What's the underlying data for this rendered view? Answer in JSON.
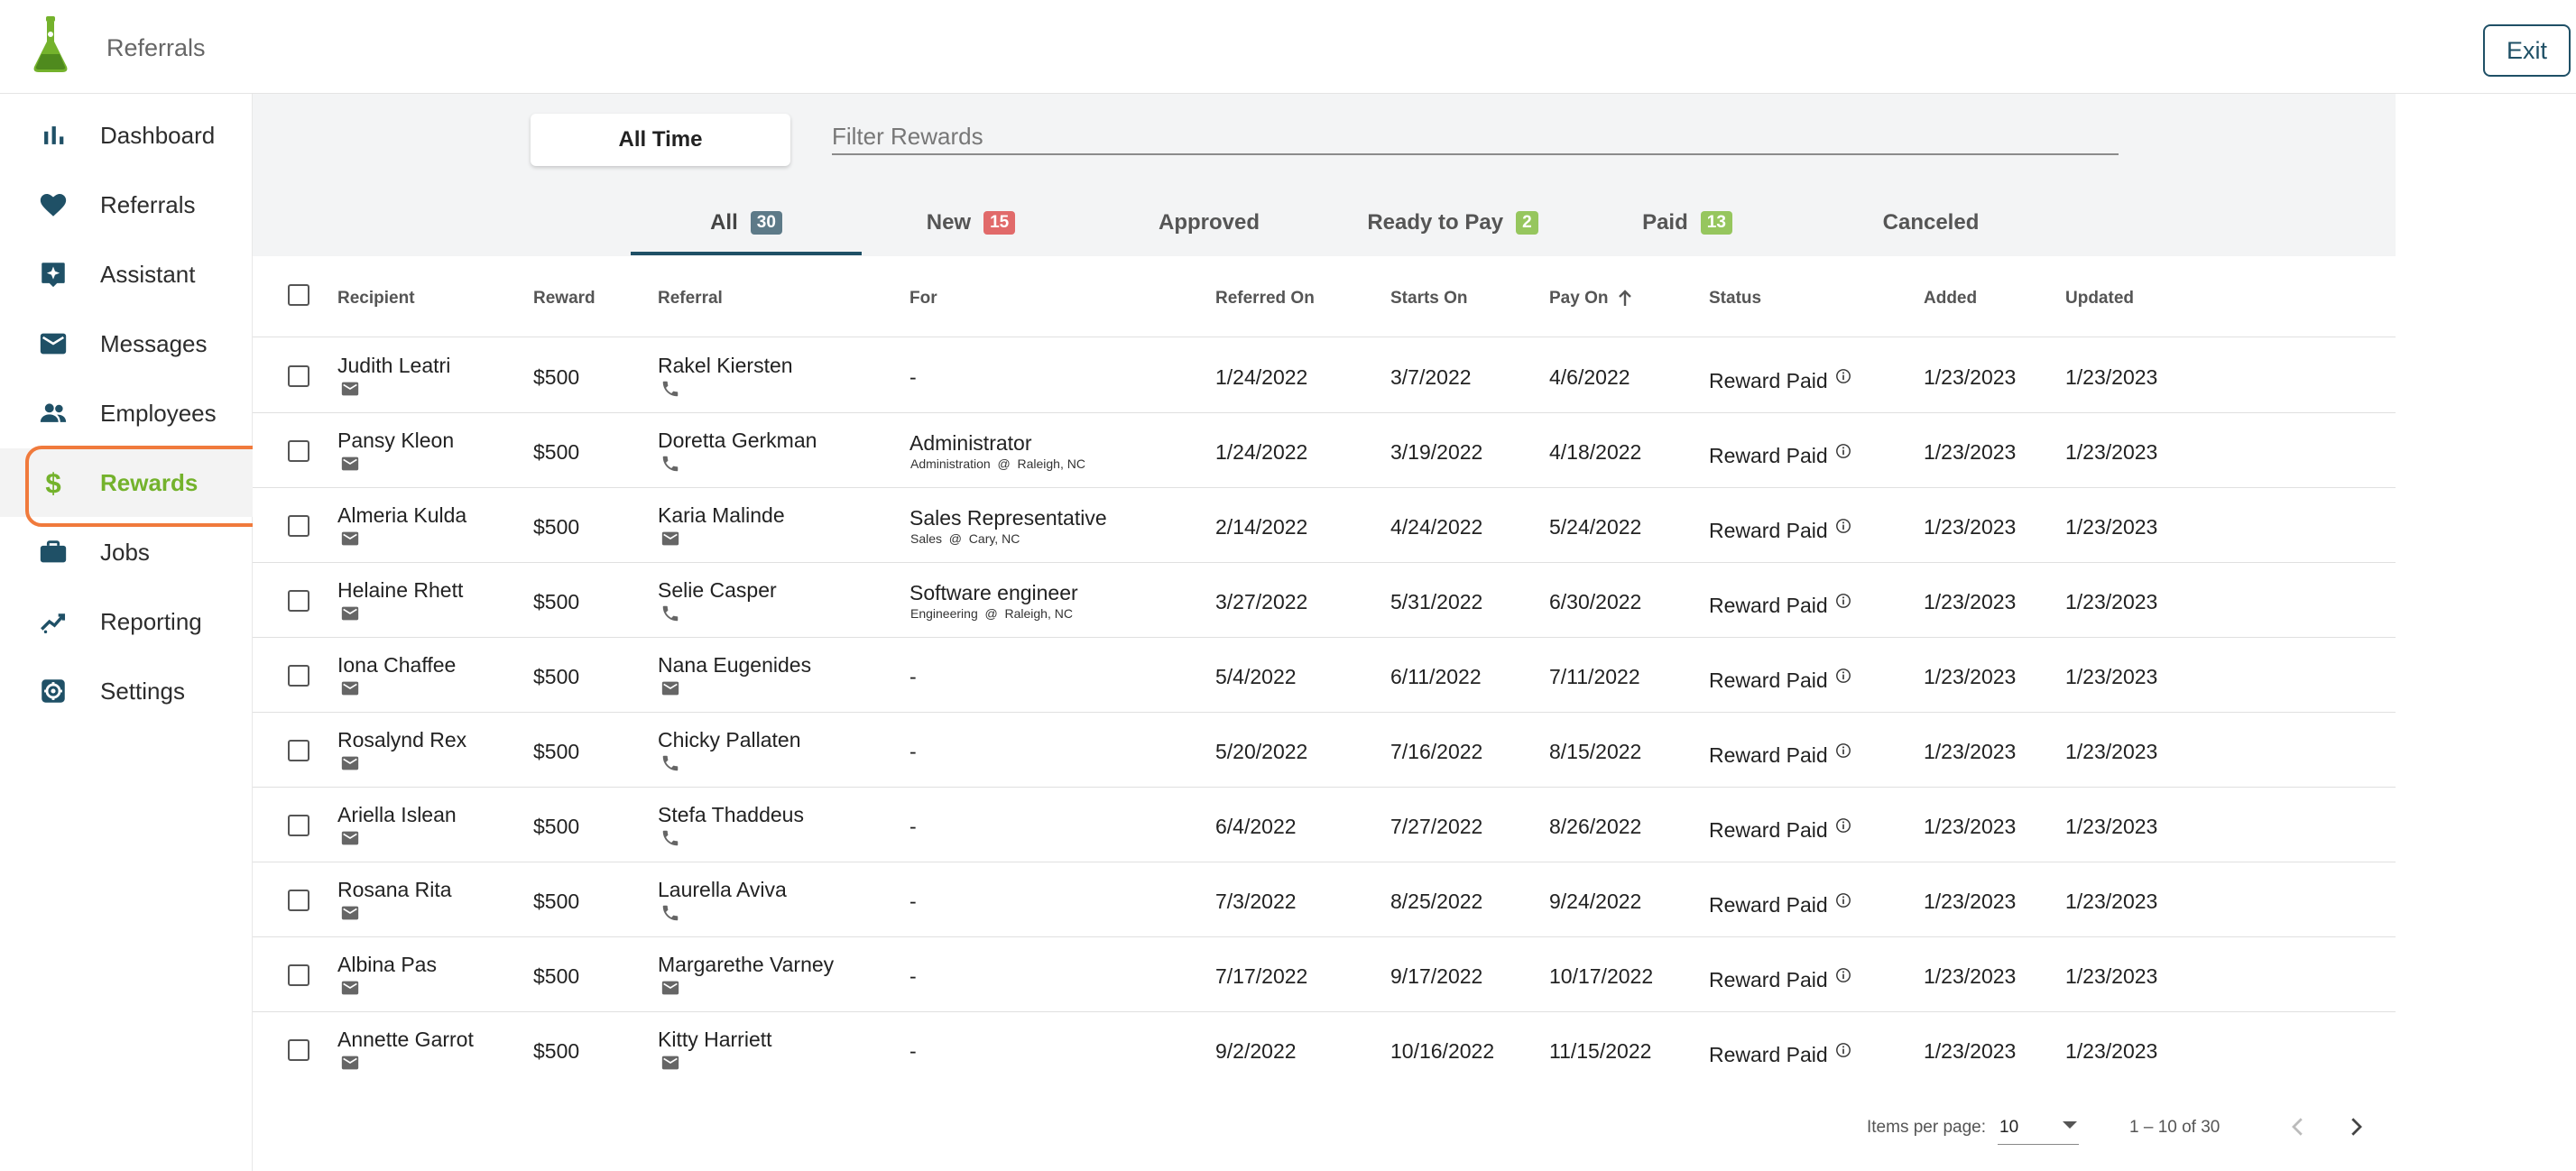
{
  "app": {
    "title": "Referrals",
    "exit_label": "Exit"
  },
  "sidebar": {
    "items": [
      {
        "label": "Dashboard",
        "icon": "bar-chart-icon"
      },
      {
        "label": "Referrals",
        "icon": "heart-icon"
      },
      {
        "label": "Assistant",
        "icon": "sparkle-icon"
      },
      {
        "label": "Messages",
        "icon": "mail-icon"
      },
      {
        "label": "Employees",
        "icon": "people-icon"
      },
      {
        "label": "Rewards",
        "icon": "dollar-icon",
        "active": true
      },
      {
        "label": "Jobs",
        "icon": "briefcase-icon"
      },
      {
        "label": "Reporting",
        "icon": "trending-icon"
      },
      {
        "label": "Settings",
        "icon": "gear-icon"
      }
    ]
  },
  "filter": {
    "time_label": "All Time",
    "placeholder": "Filter Rewards"
  },
  "tabs": [
    {
      "label": "All",
      "count": "30",
      "badge": "gray"
    },
    {
      "label": "New",
      "count": "15",
      "badge": "red"
    },
    {
      "label": "Approved",
      "count": "",
      "badge": ""
    },
    {
      "label": "Ready to Pay",
      "count": "2",
      "badge": "green"
    },
    {
      "label": "Paid",
      "count": "13",
      "badge": "green"
    },
    {
      "label": "Canceled",
      "count": "",
      "badge": ""
    }
  ],
  "columns": [
    "Recipient",
    "Reward",
    "Referral",
    "For",
    "Referred On",
    "Starts On",
    "Pay On",
    "Status",
    "Added",
    "Updated"
  ],
  "rows": [
    {
      "recipient": "Judith Leatri",
      "recipient_icon": "mail-icon",
      "reward": "$500",
      "referral": "Rakel Kiersten",
      "referral_icon": "phone-icon",
      "for": "-",
      "for_sub": "",
      "referred_on": "1/24/2022",
      "starts_on": "3/7/2022",
      "pay_on": "4/6/2022",
      "status": "Reward Paid",
      "added": "1/23/2023",
      "updated": "1/23/2023"
    },
    {
      "recipient": "Pansy Kleon",
      "recipient_icon": "mail-icon",
      "reward": "$500",
      "referral": "Doretta Gerkman",
      "referral_icon": "phone-icon",
      "for": "Administrator",
      "for_sub": "Administration  @  Raleigh, NC",
      "referred_on": "1/24/2022",
      "starts_on": "3/19/2022",
      "pay_on": "4/18/2022",
      "status": "Reward Paid",
      "added": "1/23/2023",
      "updated": "1/23/2023"
    },
    {
      "recipient": "Almeria Kulda",
      "recipient_icon": "mail-icon",
      "reward": "$500",
      "referral": "Karia Malinde",
      "referral_icon": "mail-icon",
      "for": "Sales Representative",
      "for_sub": "Sales  @  Cary, NC",
      "referred_on": "2/14/2022",
      "starts_on": "4/24/2022",
      "pay_on": "5/24/2022",
      "status": "Reward Paid",
      "added": "1/23/2023",
      "updated": "1/23/2023"
    },
    {
      "recipient": "Helaine Rhett",
      "recipient_icon": "mail-icon",
      "reward": "$500",
      "referral": "Selie Casper",
      "referral_icon": "phone-icon",
      "for": "Software engineer",
      "for_sub": "Engineering  @  Raleigh, NC",
      "referred_on": "3/27/2022",
      "starts_on": "5/31/2022",
      "pay_on": "6/30/2022",
      "status": "Reward Paid",
      "added": "1/23/2023",
      "updated": "1/23/2023"
    },
    {
      "recipient": "Iona Chaffee",
      "recipient_icon": "mail-icon",
      "reward": "$500",
      "referral": "Nana Eugenides",
      "referral_icon": "mail-icon",
      "for": "-",
      "for_sub": "",
      "referred_on": "5/4/2022",
      "starts_on": "6/11/2022",
      "pay_on": "7/11/2022",
      "status": "Reward Paid",
      "added": "1/23/2023",
      "updated": "1/23/2023"
    },
    {
      "recipient": "Rosalynd Rex",
      "recipient_icon": "mail-icon",
      "reward": "$500",
      "referral": "Chicky Pallaten",
      "referral_icon": "phone-icon",
      "for": "-",
      "for_sub": "",
      "referred_on": "5/20/2022",
      "starts_on": "7/16/2022",
      "pay_on": "8/15/2022",
      "status": "Reward Paid",
      "added": "1/23/2023",
      "updated": "1/23/2023"
    },
    {
      "recipient": "Ariella Islean",
      "recipient_icon": "mail-icon",
      "reward": "$500",
      "referral": "Stefa Thaddeus",
      "referral_icon": "phone-icon",
      "for": "-",
      "for_sub": "",
      "referred_on": "6/4/2022",
      "starts_on": "7/27/2022",
      "pay_on": "8/26/2022",
      "status": "Reward Paid",
      "added": "1/23/2023",
      "updated": "1/23/2023"
    },
    {
      "recipient": "Rosana Rita",
      "recipient_icon": "mail-icon",
      "reward": "$500",
      "referral": "Laurella Aviva",
      "referral_icon": "phone-icon",
      "for": "-",
      "for_sub": "",
      "referred_on": "7/3/2022",
      "starts_on": "8/25/2022",
      "pay_on": "9/24/2022",
      "status": "Reward Paid",
      "added": "1/23/2023",
      "updated": "1/23/2023"
    },
    {
      "recipient": "Albina Pas",
      "recipient_icon": "mail-icon",
      "reward": "$500",
      "referral": "Margarethe Varney",
      "referral_icon": "mail-icon",
      "for": "-",
      "for_sub": "",
      "referred_on": "7/17/2022",
      "starts_on": "9/17/2022",
      "pay_on": "10/17/2022",
      "status": "Reward Paid",
      "added": "1/23/2023",
      "updated": "1/23/2023"
    },
    {
      "recipient": "Annette Garrot",
      "recipient_icon": "mail-icon",
      "reward": "$500",
      "referral": "Kitty Harriett",
      "referral_icon": "mail-icon",
      "for": "-",
      "for_sub": "",
      "referred_on": "9/2/2022",
      "starts_on": "10/16/2022",
      "pay_on": "11/15/2022",
      "status": "Reward Paid",
      "added": "1/23/2023",
      "updated": "1/23/2023"
    }
  ],
  "pagination": {
    "items_per_page_label": "Items per page:",
    "items_per_page": "10",
    "range": "1 – 10 of 30"
  },
  "colors": {
    "accent": "#74b22c",
    "brand": "#1f5066",
    "highlight": "#f07a3c"
  }
}
